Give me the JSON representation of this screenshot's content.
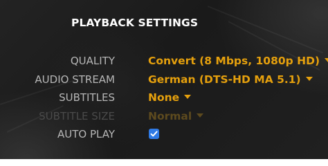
{
  "panel": {
    "title": "PLAYBACK SETTINGS"
  },
  "settings": [
    {
      "label": "QUALITY",
      "value": "Convert (8 Mbps, 1080p HD)",
      "enabled": true
    },
    {
      "label": "AUDIO STREAM",
      "value": "German (DTS-HD MA 5.1)",
      "enabled": true
    },
    {
      "label": "SUBTITLES",
      "value": "None",
      "enabled": true
    },
    {
      "label": "SUBTITLE SIZE",
      "value": "Normal",
      "enabled": false
    }
  ],
  "auto_play": {
    "label": "AUTO PLAY",
    "checked": true
  },
  "colors": {
    "accent": "#e5a00d",
    "checkbox": "#2f7ae5",
    "label": "#b7b7b7",
    "title": "#ffffff",
    "disabled_label": "#4a4a4a",
    "disabled_value": "#5d4a1e"
  },
  "icons": {
    "dropdown": "chevron-down-icon",
    "check": "checkmark-icon"
  }
}
